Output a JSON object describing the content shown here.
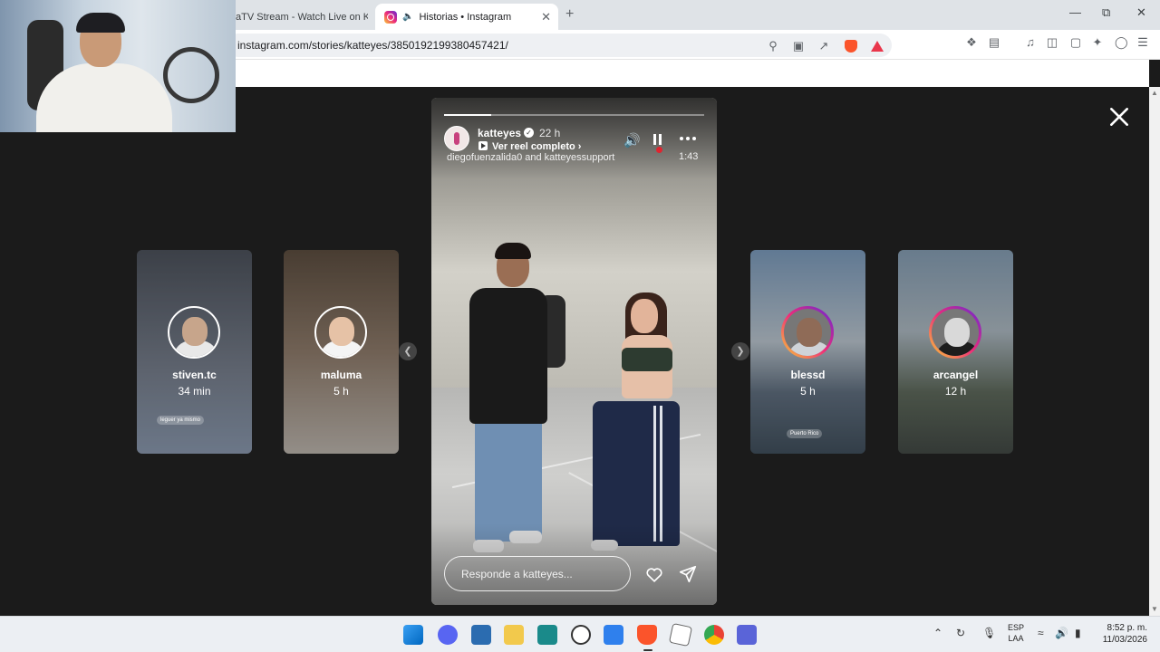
{
  "browser": {
    "tabs": [
      {
        "label": "aTV Stream - Watch Live on Kick",
        "active": false
      },
      {
        "label": "Historias • Instagram",
        "active": true
      }
    ],
    "url": "instagram.com/stories/katteyes/3850192199380457421/",
    "new_tab_icon": "plus-icon"
  },
  "story": {
    "username": "katteyes",
    "verified": true,
    "time_ago": "22 h",
    "reel_link": "Ver reel completo",
    "collaborators": "diegofuenzalida0 and katteyessupport",
    "duration": "1:43",
    "progress": 0.18,
    "reply_placeholder": "Responde a katteyes...",
    "icons": [
      "volume-icon",
      "pause-icon",
      "more-icon",
      "heart-icon",
      "send-icon",
      "close-icon"
    ]
  },
  "side_stories": [
    {
      "username": "stiven.tc",
      "time": "34 min",
      "sticker": "leguer ya mismo"
    },
    {
      "username": "maluma",
      "time": "5 h"
    },
    {
      "username": "blessd",
      "time": "5 h",
      "sticker": "Puerto Rico"
    },
    {
      "username": "arcangel",
      "time": "12 h"
    }
  ],
  "taskbar": {
    "language": "ESP",
    "layout": "LAA",
    "time": "8:52 p. m.",
    "date": "11/03/2026"
  }
}
